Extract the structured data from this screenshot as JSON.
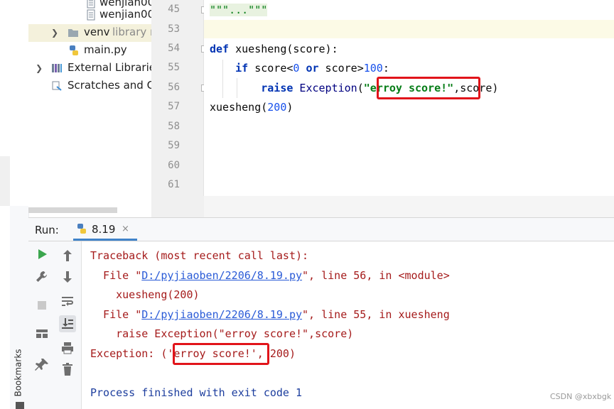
{
  "project_tree": {
    "items": [
      {
        "label": "wenjian00"
      },
      {
        "label": "wenjian00"
      },
      {
        "label": "venv",
        "secondary": "library r"
      },
      {
        "label": "main.py"
      },
      {
        "label": "External Librarie"
      },
      {
        "label": "Scratches and Co"
      }
    ]
  },
  "editor": {
    "line_numbers": [
      "45",
      "53",
      "54",
      "55",
      "56",
      "57",
      "58",
      "59",
      "60",
      "61"
    ],
    "code": {
      "l45": "\"\"\"...\"\"\"",
      "l54_kw": "def",
      "l54_rest": " xuesheng(score):",
      "l55_kw1": "if",
      "l55_a": " score<",
      "l55_n1": "0",
      "l55_kw2": " or",
      "l55_b": " score>",
      "l55_n2": "100",
      "l55_c": ":",
      "l56_kw": "raise",
      "l56_cls": " Exception",
      "l56_paren": "(",
      "l56_str": "\"erroy score!\"",
      "l56_rest": ",score)",
      "l57_a": "xuesheng(",
      "l57_n": "200",
      "l57_b": ")"
    }
  },
  "run_panel": {
    "label": "Run:",
    "tab_name": "8.19",
    "tab_close": "×"
  },
  "console": {
    "line1": "Traceback (most recent call last):",
    "line2_a": "  File \"",
    "line2_link": "D:/pyjiaoben/2206/8.19.py",
    "line2_b": "\", line 56, in <module>",
    "line3": "    xuesheng(200)",
    "line4_a": "  File \"",
    "line4_link": "D:/pyjiaoben/2206/8.19.py",
    "line4_b": "\", line 55, in xuesheng",
    "line5": "    raise Exception(\"erroy score!\",score)",
    "line6": "Exception: ('erroy score!', 200)",
    "line8": "Process finished with exit code 1"
  },
  "sidebar": {
    "bookmarks_label": "Bookmarks"
  },
  "watermark": "CSDN @xbxbgk",
  "colors": {
    "accent": "#4083c9",
    "error_text": "#a51b1b",
    "highlight_box": "#e1141a",
    "link": "#2a5bd7"
  }
}
